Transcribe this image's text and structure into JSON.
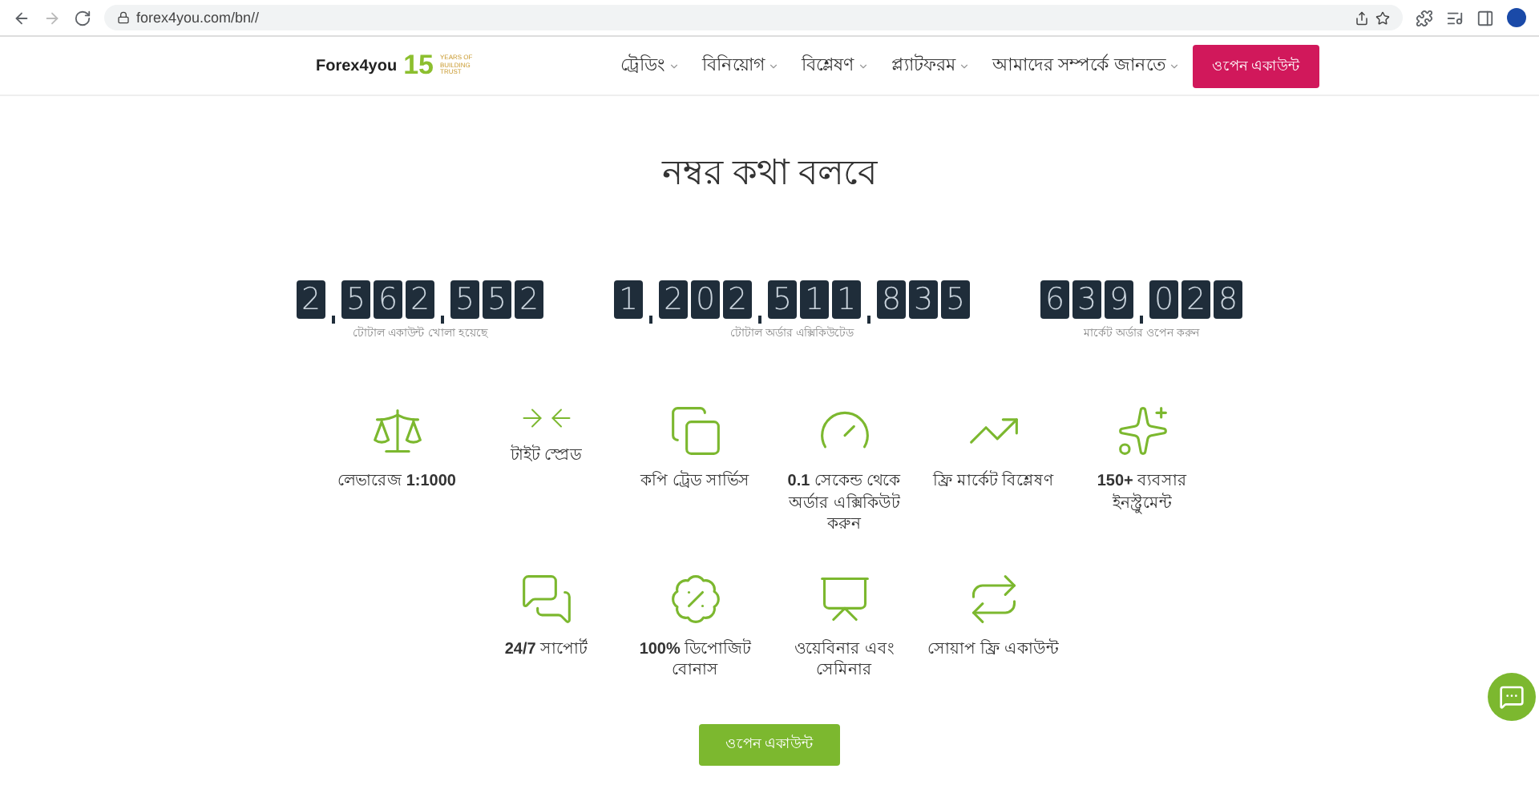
{
  "browser": {
    "url": "forex4you.com/bn//"
  },
  "header": {
    "logo": {
      "brand": "Forex4you",
      "years": "15",
      "tagline": "YEARS OF BUILDING TRUST"
    },
    "nav": [
      {
        "label": "ট্রেডিং"
      },
      {
        "label": "বিনিয়োগ"
      },
      {
        "label": "বিশ্লেষণ"
      },
      {
        "label": "প্ল্যাটফরম"
      },
      {
        "label": "আমাদের সম্পর্কে জানতে"
      }
    ],
    "cta": "ওপেন একাউন্ট"
  },
  "title": "নম্বর কথা বলবে",
  "counters": [
    {
      "groups": [
        [
          "2"
        ],
        [
          "5",
          "6",
          "2"
        ],
        [
          "5",
          "5",
          "2"
        ]
      ],
      "label": "টোটাল একাউন্ট খোলা হয়েছে"
    },
    {
      "groups": [
        [
          "1"
        ],
        [
          "2",
          "0",
          "2"
        ],
        [
          "5",
          "1",
          "1"
        ],
        [
          "8",
          "3",
          "5"
        ]
      ],
      "label": "টোটাল অর্ডার এক্সিকিউটেড"
    },
    {
      "groups": [
        [
          "6",
          "3",
          "9"
        ],
        [
          "0",
          "2",
          "8"
        ]
      ],
      "label": "মার্কেট অর্ডার ওপেন করুন"
    }
  ],
  "features": [
    [
      {
        "kind": "scale",
        "text": "লেভারেজ **1:1000**"
      },
      {
        "kind": "arrows",
        "text": "টাইট স্প্রেড"
      },
      {
        "kind": "copy",
        "text": "কপি ট্রেড সার্ভিস"
      },
      {
        "kind": "gauge",
        "text": "**0.1** সেকেন্ড থেকে অর্ডার এক্সিকিউট করুন"
      },
      {
        "kind": "chart",
        "text": "ফ্রি মার্কেট বিশ্লেষণ"
      },
      {
        "kind": "gold",
        "text": "**150+** ব্যবসার ইনস্ট্রুমেন্ট"
      }
    ],
    [
      {
        "kind": "chat",
        "text": "**24/7** সাপোর্ট"
      },
      {
        "kind": "percent",
        "text": "**100%** ডিপোজিট বোনাস"
      },
      {
        "kind": "presentation",
        "text": "ওয়েবিনার এবং সেমিনার"
      },
      {
        "kind": "swap",
        "text": "সোয়াপ ফ্রি একাউন্ট"
      }
    ]
  ],
  "open_button": "ওপেন একাউন্ট"
}
